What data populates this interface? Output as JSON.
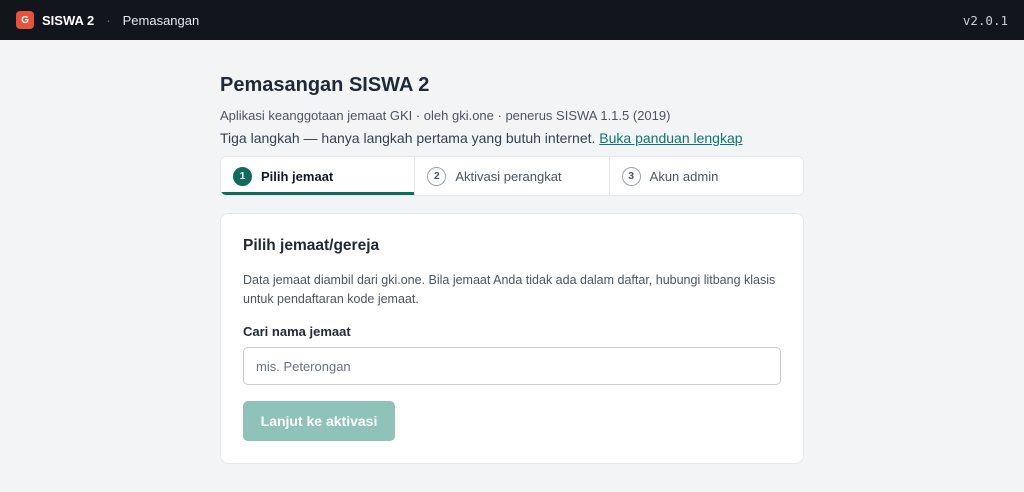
{
  "topbar": {
    "logo_letter": "G",
    "app_name": "SISWA 2",
    "separator": "·",
    "breadcrumb": "Pemasangan",
    "version": "v2.0.1"
  },
  "header": {
    "title": "Pemasangan SISWA 2",
    "subtitle": "Aplikasi keanggotaan jemaat GKI · oleh gki.one · penerus SISWA 1.1.5 (2019)",
    "intro_text": "Tiga langkah — hanya langkah pertama yang butuh internet.",
    "guide_link": "Buka panduan lengkap"
  },
  "steps": [
    {
      "number": "1",
      "label": "Pilih jemaat",
      "active": true
    },
    {
      "number": "2",
      "label": "Aktivasi perangkat",
      "active": false
    },
    {
      "number": "3",
      "label": "Akun admin",
      "active": false
    }
  ],
  "card": {
    "title": "Pilih jemaat/gereja",
    "description": "Data jemaat diambil dari gki.one. Bila jemaat Anda tidak ada dalam daftar, hubungi litbang klasis untuk pendaftaran kode jemaat.",
    "search_label": "Cari nama jemaat",
    "search_value": "",
    "search_placeholder": "mis. Peterongan",
    "next_button": "Lanjut ke aktivasi",
    "next_button_enabled": false
  },
  "colors": {
    "topbar_bg": "#12151c",
    "logo_bg": "#e5533d",
    "accent": "#0f6b5c",
    "button_disabled": "#8fc2b8",
    "page_bg": "#f3f4f6"
  }
}
